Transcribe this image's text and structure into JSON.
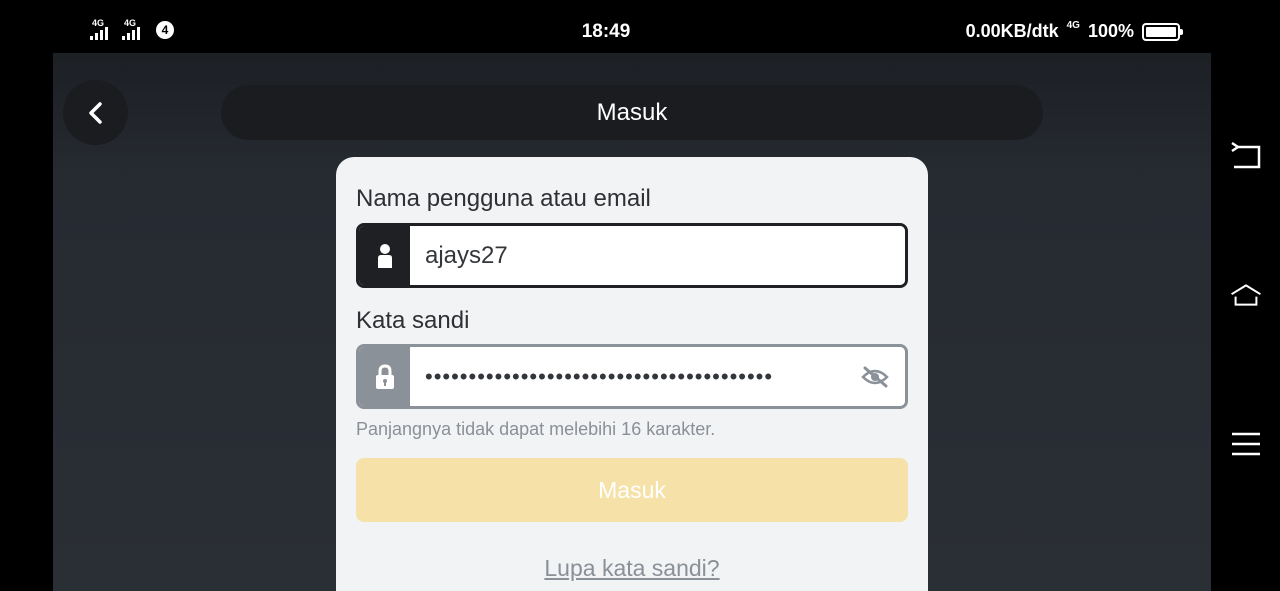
{
  "status_bar": {
    "network_left_1": "4G",
    "network_left_2": "4G",
    "sim_badge": "4",
    "time": "18:49",
    "data_speed": "0.00KB/dtk",
    "network_right": "4G",
    "battery_percent": "100%"
  },
  "header": {
    "back_icon": "chevron-left-icon",
    "title": "Masuk"
  },
  "form": {
    "username_label": "Nama pengguna atau email",
    "username_value": "ajays27",
    "username_icon": "user-icon",
    "password_label": "Kata sandi",
    "password_value": "••••••••••••••••••••••••••••••••••••••••",
    "password_icon": "lock-icon",
    "visibility_icon": "eye-off-icon",
    "password_hint": "Panjangnya tidak dapat melebihi 16 karakter.",
    "submit_label": "Masuk",
    "forgot_link": "Lupa kata sandi?"
  },
  "nav_bar": {
    "back_icon": "system-back-icon",
    "home_icon": "system-home-icon",
    "menu_icon": "system-menu-icon"
  },
  "colors": {
    "app_background": "#262a31",
    "card_background": "#f2f3f5",
    "submit_disabled": "#f6e2a8",
    "active_border": "#1e2023",
    "inactive_border": "#8b9199"
  }
}
